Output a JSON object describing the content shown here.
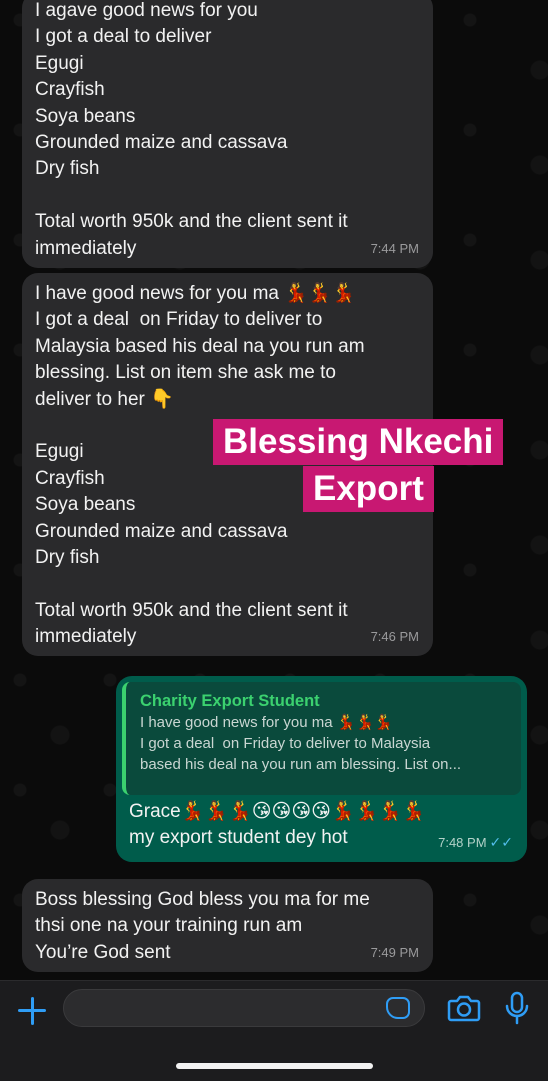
{
  "colors": {
    "incoming_bubble": "#2a2a2c",
    "outgoing_bubble": "#005c4b",
    "quote_accent": "#3bd16f",
    "overlay_bg": "#c81872",
    "ui_accent": "#2f9df5",
    "read_ticks": "#53bdeb"
  },
  "messages": [
    {
      "direction": "incoming",
      "lines": [
        "I agave good news for you",
        "I got a deal to deliver",
        "Egugi",
        "Crayfish",
        "Soya beans",
        "Grounded maize and cassava",
        "Dry fish",
        "",
        "Total worth 950k and the client sent it",
        "immediately"
      ],
      "time": "7:44 PM"
    },
    {
      "direction": "incoming",
      "lines": [
        "I have good news for you ma 💃💃💃",
        "I got a deal  on Friday to deliver to",
        "Malaysia based his deal na you run am",
        "blessing. List on item she ask me to",
        "deliver to her 👇",
        "",
        "Egugi",
        "Crayfish",
        "Soya beans",
        "Grounded maize and cassava",
        "Dry fish",
        "",
        "Total worth 950k and the client sent it",
        "immediately"
      ],
      "time": "7:46 PM"
    },
    {
      "direction": "outgoing",
      "quote": {
        "author": "Charity Export Student",
        "lines": [
          "I have good news for you ma 💃💃💃",
          "I got a deal  on Friday to deliver to Malaysia",
          "based his deal na you run am blessing. List on..."
        ]
      },
      "lines": [
        "Grace💃💃💃😘😘😘😘💃💃💃💃",
        "my export student dey hot"
      ],
      "time": "7:48 PM",
      "read_ticks": "✓✓"
    },
    {
      "direction": "incoming",
      "lines": [
        "Boss blessing God bless you ma for me",
        "thsi one na your training run am",
        "You’re God sent"
      ],
      "time": "7:49 PM"
    }
  ],
  "overlay": {
    "line1": "Blessing Nkechi",
    "line2": "Export"
  },
  "input_bar": {
    "placeholder": "",
    "icons": [
      "plus-icon",
      "sticker-icon",
      "camera-icon",
      "microphone-icon"
    ]
  }
}
